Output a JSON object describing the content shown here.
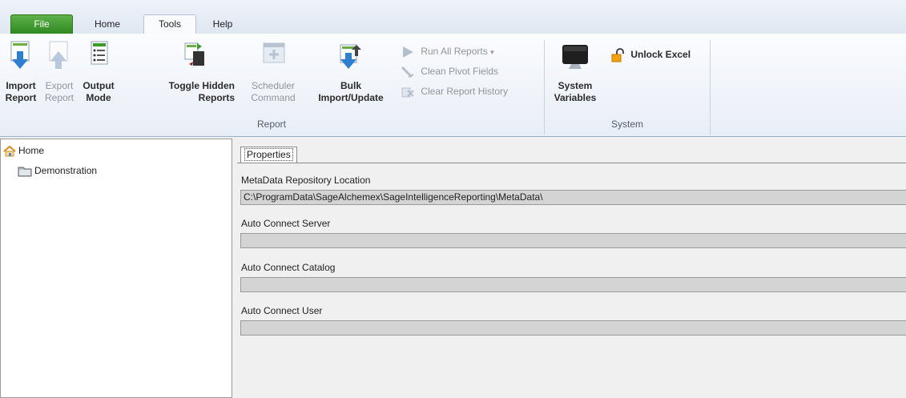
{
  "tabs": {
    "file": "File",
    "home": "Home",
    "tools": "Tools",
    "help": "Help"
  },
  "ribbon": {
    "report_group": {
      "label": "Report",
      "import_report": "Import\nReport",
      "export_report": "Export\nReport",
      "output_mode": "Output\nMode",
      "toggle_hidden": "Toggle Hidden\nReports",
      "scheduler": "Scheduler\nCommand",
      "bulk": "Bulk\nImport/Update",
      "run_all": "Run All Reports",
      "clean_pivot": "Clean Pivot Fields",
      "clear_history": "Clear Report History"
    },
    "system_group": {
      "label": "System",
      "system_variables": "System\nVariables",
      "unlock_excel": "Unlock Excel"
    }
  },
  "tree": {
    "root": "Home",
    "child": "Demonstration"
  },
  "properties": {
    "tab": "Properties",
    "metadata_label": "MetaData Repository Location",
    "metadata_value": "C:\\ProgramData\\SageAlchemex\\SageIntelligenceReporting\\MetaData\\",
    "server_label": "Auto Connect Server",
    "server_value": "",
    "catalog_label": "Auto Connect Catalog",
    "catalog_value": "",
    "user_label": "Auto Connect User",
    "user_value": ""
  },
  "colors": {
    "file_tab": "#3c9a2c",
    "accent_blue": "#2d7fd0",
    "disabled": "#8f969f"
  },
  "icons": [
    "import-icon",
    "export-icon",
    "output-mode-icon",
    "toggle-hidden-icon",
    "scheduler-icon",
    "bulk-import-icon",
    "run-icon",
    "clean-icon",
    "clear-history-icon",
    "monitor-icon",
    "unlock-icon",
    "home-icon",
    "folder-icon"
  ]
}
